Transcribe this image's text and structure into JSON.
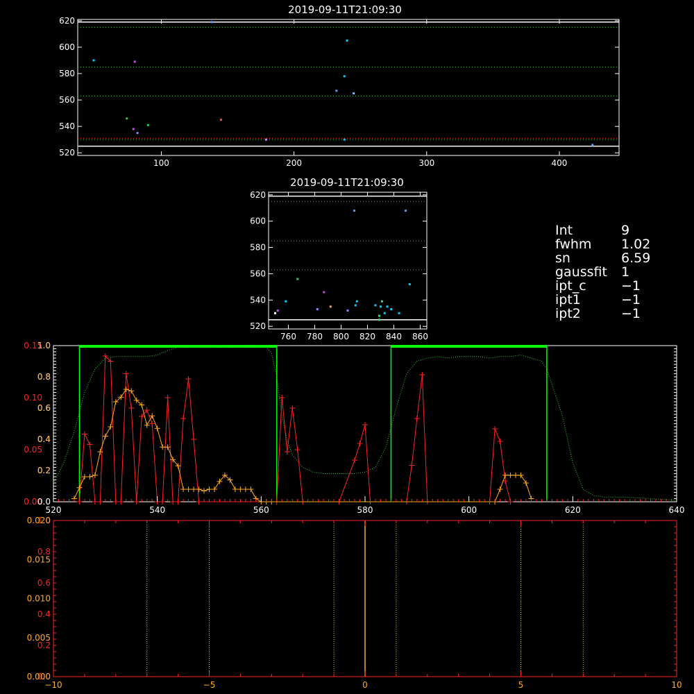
{
  "info_panel": {
    "rows": [
      {
        "key": "Int",
        "value": "9"
      },
      {
        "key": "fwhm",
        "value": "1.02"
      },
      {
        "key": "sn",
        "value": "6.59"
      },
      {
        "key": "gaussfit",
        "value": "1"
      },
      {
        "key": "ipt_c",
        "value": "−1"
      },
      {
        "key": "ipt1",
        "value": "−1"
      },
      {
        "key": "ipt2",
        "value": "−1"
      }
    ]
  },
  "colors": {
    "axes": "#ffffff",
    "green_dotted": "#33cc33",
    "red": "#ff2222",
    "orange": "#ffaa22",
    "bright_green": "#00ff00",
    "yellow_dotted": "#cccc44",
    "grid_dotted": "#aaaa66"
  },
  "chart_data": [
    {
      "type": "scatter",
      "title": "2019-09-11T21:09:30",
      "xlim": [
        37,
        445
      ],
      "ylim": [
        518,
        621
      ],
      "x_ticks": [
        100,
        200,
        300,
        400
      ],
      "y_ticks": [
        520,
        540,
        560,
        580,
        600,
        620
      ],
      "hlines_white": [
        525,
        619
      ],
      "hlines_green_dotted": [
        530,
        563,
        585,
        615
      ],
      "hlines_red_dotted": [
        531
      ],
      "points": [
        {
          "x": 138,
          "y": 619,
          "c": "#5599ff"
        },
        {
          "x": 240,
          "y": 605,
          "c": "#00ccff"
        },
        {
          "x": 49,
          "y": 590,
          "c": "#00ccff"
        },
        {
          "x": 80,
          "y": 589,
          "c": "#cc44ff"
        },
        {
          "x": 238,
          "y": 578,
          "c": "#00ccff"
        },
        {
          "x": 232,
          "y": 567,
          "c": "#5599ff"
        },
        {
          "x": 245,
          "y": 565,
          "c": "#88bbff"
        },
        {
          "x": 74,
          "y": 546,
          "c": "#22cc22"
        },
        {
          "x": 145,
          "y": 545,
          "c": "#ff4444"
        },
        {
          "x": 90,
          "y": 541,
          "c": "#22cc66"
        },
        {
          "x": 79,
          "y": 538,
          "c": "#cc44ff"
        },
        {
          "x": 82,
          "y": 535,
          "c": "#8888ff"
        },
        {
          "x": 179,
          "y": 530,
          "c": "#cc88ff"
        },
        {
          "x": 238,
          "y": 530,
          "c": "#00ccff"
        },
        {
          "x": 425,
          "y": 526,
          "c": "#5599ff"
        }
      ]
    },
    {
      "type": "scatter",
      "title": "2019-09-11T21:09:30",
      "xlim": [
        745,
        865
      ],
      "ylim": [
        518,
        622
      ],
      "x_ticks": [
        760,
        780,
        800,
        820,
        840,
        860
      ],
      "y_ticks": [
        520,
        540,
        560,
        580,
        600,
        620
      ],
      "hlines_white": [
        525,
        619
      ],
      "hlines_green_dotted": [
        563,
        585,
        615
      ],
      "points": [
        {
          "x": 810,
          "y": 608,
          "c": "#5599ff"
        },
        {
          "x": 849,
          "y": 608,
          "c": "#5599ff"
        },
        {
          "x": 852,
          "y": 552,
          "c": "#00ccff"
        },
        {
          "x": 767,
          "y": 556,
          "c": "#22cc66"
        },
        {
          "x": 787,
          "y": 546,
          "c": "#cc44ff"
        },
        {
          "x": 758,
          "y": 539,
          "c": "#00ccff"
        },
        {
          "x": 812,
          "y": 539,
          "c": "#00ccff"
        },
        {
          "x": 811,
          "y": 536,
          "c": "#00ccff"
        },
        {
          "x": 831,
          "y": 539,
          "c": "#22ee88"
        },
        {
          "x": 826,
          "y": 536,
          "c": "#00ccff"
        },
        {
          "x": 830,
          "y": 535,
          "c": "#00ccff"
        },
        {
          "x": 835,
          "y": 535,
          "c": "#00ccff"
        },
        {
          "x": 838,
          "y": 533,
          "c": "#00ccff"
        },
        {
          "x": 833,
          "y": 530,
          "c": "#00ccff"
        },
        {
          "x": 844,
          "y": 530,
          "c": "#00ccff"
        },
        {
          "x": 829,
          "y": 528,
          "c": "#22ee88"
        },
        {
          "x": 752,
          "y": 532,
          "c": "#cc44ff"
        },
        {
          "x": 750,
          "y": 530,
          "c": "#ffffff"
        },
        {
          "x": 782,
          "y": 533,
          "c": "#8888ff"
        },
        {
          "x": 792,
          "y": 535,
          "c": "#ffaa22"
        },
        {
          "x": 805,
          "y": 532,
          "c": "#8888ff"
        },
        {
          "x": 829,
          "y": 525,
          "c": "#22ee88"
        }
      ]
    },
    {
      "type": "line",
      "xlim": [
        520,
        640
      ],
      "x_ticks": [
        520,
        540,
        560,
        580,
        600,
        620,
        640
      ],
      "left_axis_red": {
        "ylim": [
          0,
          0.15
        ],
        "ticks": [
          "0.00",
          "0.05",
          "0.10",
          "0.15"
        ],
        "tick_values": [
          0,
          0.05,
          0.1,
          0.15
        ]
      },
      "left_axis_white": {
        "ylim": [
          0,
          1.0
        ],
        "ticks": [
          "0.0",
          "0.2",
          "0.4",
          "0.6",
          "0.8",
          "1.0"
        ],
        "tick_values": [
          0,
          0.2,
          0.4,
          0.6,
          0.8,
          1.0
        ]
      },
      "left_axis_orange": {
        "ylim": [
          0,
          1.0
        ],
        "ticks": [
          "0.2",
          "0.4",
          "0.6",
          "0.8",
          "1.0"
        ],
        "tick_values": [
          0.2,
          0.4,
          0.6,
          0.8,
          1.0
        ]
      },
      "green_boxes": [
        [
          525,
          563
        ],
        [
          585,
          615
        ]
      ],
      "green_dotted_curve": {
        "x": [
          520,
          522,
          524,
          526,
          528,
          530,
          532,
          534,
          536,
          538,
          540,
          542,
          544,
          546,
          548,
          550,
          552,
          554,
          556,
          558,
          560,
          561,
          562,
          563,
          564,
          565,
          566,
          568,
          570,
          572,
          574,
          576,
          578,
          580,
          582,
          584,
          586,
          588,
          590,
          592,
          594,
          596,
          598,
          600,
          602,
          604,
          606,
          608,
          610,
          612,
          614,
          615,
          616,
          617,
          618,
          620,
          622,
          624,
          626,
          630,
          635,
          640
        ],
        "y": [
          0.12,
          0.25,
          0.45,
          0.7,
          0.85,
          0.92,
          0.93,
          0.93,
          0.93,
          0.93,
          0.94,
          0.97,
          0.99,
          1.0,
          0.99,
          0.99,
          1.0,
          0.99,
          0.99,
          0.99,
          1.0,
          0.99,
          0.95,
          0.8,
          0.55,
          0.4,
          0.3,
          0.22,
          0.19,
          0.18,
          0.18,
          0.18,
          0.18,
          0.19,
          0.22,
          0.35,
          0.6,
          0.82,
          0.9,
          0.92,
          0.93,
          0.92,
          0.93,
          0.93,
          0.93,
          0.92,
          0.93,
          0.93,
          0.94,
          0.92,
          0.9,
          0.85,
          0.75,
          0.65,
          0.55,
          0.25,
          0.08,
          0.04,
          0.03,
          0.03,
          0.02,
          0.01
        ]
      },
      "red_series": {
        "x": [
          525,
          526,
          527,
          528,
          529,
          530,
          531,
          532,
          533,
          534,
          535,
          536,
          537,
          538,
          539,
          540,
          541,
          542,
          543,
          544,
          545,
          546,
          547,
          548,
          563,
          564,
          565,
          566,
          567,
          568,
          575,
          578,
          579,
          580,
          581,
          588,
          589,
          590,
          591,
          592,
          604,
          605,
          606,
          607,
          608
        ],
        "y": [
          0,
          0.065,
          0.055,
          0,
          0,
          0.14,
          0.135,
          0,
          0,
          0.123,
          0.09,
          0,
          0.082,
          0.088,
          0.075,
          0,
          0,
          0.1,
          0,
          0,
          0.08,
          0.118,
          0.06,
          0,
          0,
          0.1,
          0.048,
          0.09,
          0.05,
          0,
          0,
          0.04,
          0.056,
          0.074,
          0,
          0,
          0.035,
          0.08,
          0.122,
          0,
          0,
          0.07,
          0.058,
          0.02,
          0
        ]
      },
      "orange_series": {
        "x": [
          524,
          525,
          526,
          527,
          528,
          529,
          530,
          531,
          532,
          533,
          534,
          535,
          536,
          537,
          538,
          539,
          540,
          541,
          542,
          543,
          544,
          545,
          546,
          547,
          548,
          549,
          550,
          551,
          552,
          553,
          554,
          555,
          556,
          557,
          558,
          559,
          560,
          561,
          562,
          605,
          606,
          607,
          608,
          609,
          610,
          611,
          612
        ],
        "y": [
          0.02,
          0.09,
          0.16,
          0.16,
          0.17,
          0.32,
          0.42,
          0.48,
          0.64,
          0.67,
          0.72,
          0.71,
          0.65,
          0.62,
          0.49,
          0.55,
          0.47,
          0.35,
          0.35,
          0.27,
          0.23,
          0.08,
          0.08,
          0.08,
          0.08,
          0.07,
          0.08,
          0.08,
          0.13,
          0.17,
          0.14,
          0.08,
          0.08,
          0.08,
          0.08,
          0.02,
          0.0,
          0.0,
          0.0,
          0.0,
          0.08,
          0.17,
          0.17,
          0.17,
          0.17,
          0.12,
          0.02
        ]
      }
    },
    {
      "type": "line",
      "xlim": [
        -10,
        10
      ],
      "x_ticks": [
        -10,
        -5,
        0,
        5,
        10
      ],
      "left_axis_orange": {
        "ylim": [
          0,
          0.02
        ],
        "ticks": [
          "0.000",
          "0.005",
          "0.010",
          "0.015",
          "0.020"
        ],
        "tick_values": [
          0,
          0.005,
          0.01,
          0.015,
          0.02
        ]
      },
      "left_axis_red": {
        "ylim": [
          0,
          1.0
        ],
        "ticks": [
          "0.0",
          "0.2",
          "0.4",
          "0.6",
          "0.8",
          "1.0"
        ],
        "tick_values": [
          0,
          0.2,
          0.4,
          0.6,
          0.8,
          1.0
        ]
      },
      "vlines_dotted": [
        -7,
        -5,
        -1,
        1,
        5,
        7
      ],
      "vline_solid": 0
    }
  ]
}
